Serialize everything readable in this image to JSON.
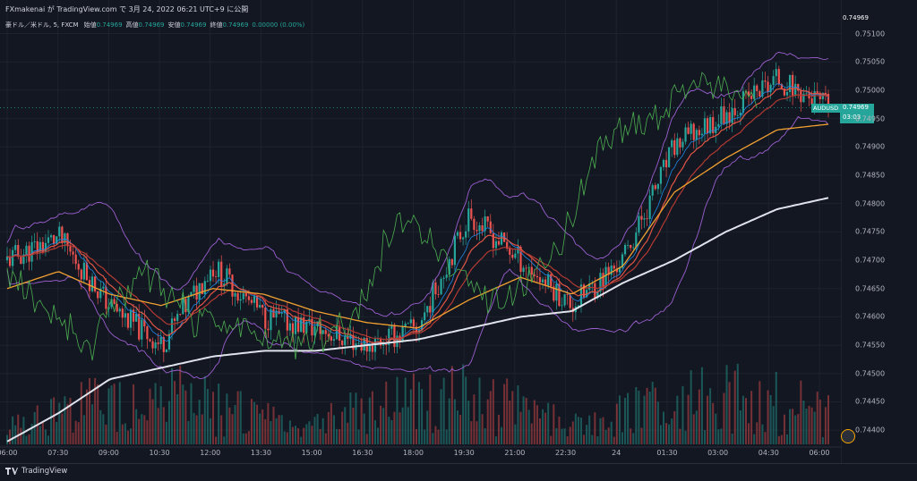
{
  "header": {
    "published": "FXmakenai が TradingView.com で 3月 24, 2022 06:21 UTC+9 に公開",
    "symbol_desc": "豪ドル／米ドル, 5, FXCM",
    "ohlc": [
      {
        "label": "始値",
        "value": "0.74969"
      },
      {
        "label": "高値",
        "value": "0.74969"
      },
      {
        "label": "安値",
        "value": "0.74969"
      },
      {
        "label": "終値",
        "value": "0.74969"
      }
    ],
    "change": "0.00000 (0.00%)"
  },
  "price_axis": {
    "labels": [
      "0.75100",
      "0.75050",
      "0.75000",
      "0.74950",
      "0.74900",
      "0.74850",
      "0.74800",
      "0.74750",
      "0.74700",
      "0.74650",
      "0.74600",
      "0.74550",
      "0.74500",
      "0.74450",
      "0.74400"
    ]
  },
  "current_price": {
    "symbol": "AUDUSD",
    "value": "0.74969",
    "countdown": "03:03"
  },
  "time_axis": {
    "labels": [
      "06:00",
      "07:30",
      "09:00",
      "10:30",
      "12:00",
      "13:30",
      "15:00",
      "16:30",
      "18:00",
      "19:30",
      "21:00",
      "22:30",
      "24",
      "01:30",
      "03:00",
      "04:30",
      "06:00"
    ]
  },
  "footer": {
    "brand": "TradingView"
  },
  "colors": {
    "background": "#131722",
    "up": "#26a69a",
    "down": "#ef5350",
    "sma_long": "#e0e3eb",
    "sma_mid": "#f0a030",
    "ema_fast": "#e05545",
    "bollinger": "#9c5fd0",
    "chikou": "#4caf50"
  },
  "chart_data": {
    "type": "candlestick",
    "symbol": "AUDUSD",
    "timeframe": "5",
    "x": [
      "06:00",
      "07:30",
      "09:00",
      "10:30",
      "12:00",
      "13:30",
      "15:00",
      "16:30",
      "18:00",
      "19:30",
      "21:00",
      "22:30",
      "24",
      "01:30",
      "03:00",
      "04:30",
      "06:00"
    ],
    "close": [
      0.747,
      0.7474,
      0.7462,
      0.7455,
      0.7469,
      0.746,
      0.7458,
      0.7455,
      0.7458,
      0.7478,
      0.747,
      0.7462,
      0.747,
      0.749,
      0.7496,
      0.7502,
      0.74969
    ],
    "sma_long": [
      0.7438,
      0.7443,
      0.7449,
      0.7451,
      0.7453,
      0.7454,
      0.7454,
      0.7455,
      0.7456,
      0.7458,
      0.746,
      0.7461,
      0.7466,
      0.747,
      0.7475,
      0.7479,
      0.7481
    ],
    "sma_mid": [
      0.7465,
      0.7468,
      0.7464,
      0.7462,
      0.7465,
      0.7464,
      0.7461,
      0.7459,
      0.7458,
      0.7463,
      0.7467,
      0.7464,
      0.7469,
      0.7482,
      0.7488,
      0.7493,
      0.7494
    ],
    "ylim": [
      0.74375,
      0.75115
    ],
    "last_price": 0.74969,
    "grid": true
  }
}
